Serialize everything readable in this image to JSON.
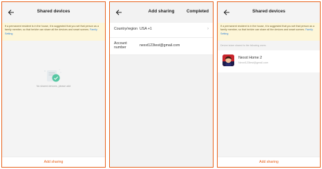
{
  "panel1": {
    "title": "Shared devices",
    "notice": "If a permanent resident is in the house, it is suggested that you set that person as a family member, so that he/she can share all the devices and smart scenes.",
    "notice_link": "Family Setting",
    "empty_text": "No shared devices, please add",
    "add_label": "Add sharing"
  },
  "panel2": {
    "title": "Add sharing",
    "done_label": "Completed",
    "rows": [
      {
        "label": "Country/region",
        "value": "USA +1"
      },
      {
        "label": "Account number",
        "value": "nexxt123test@gmail.com"
      }
    ]
  },
  "panel3": {
    "title": "Shared devices",
    "notice": "If a permanent resident is in the house, it is suggested that you set that person as a family member, so that he/she can share all the devices and smart scenes.",
    "notice_link": "Family Setting",
    "section_label": "Device is/are shared to the following users",
    "user": {
      "name": "Nexxt Home 2",
      "email": "Nexxt123test@gmail.com"
    },
    "add_label": "Add sharing"
  },
  "colors": {
    "accent": "#e8611a",
    "notice_bg": "#fdf6d8",
    "link": "#2f80d8"
  }
}
